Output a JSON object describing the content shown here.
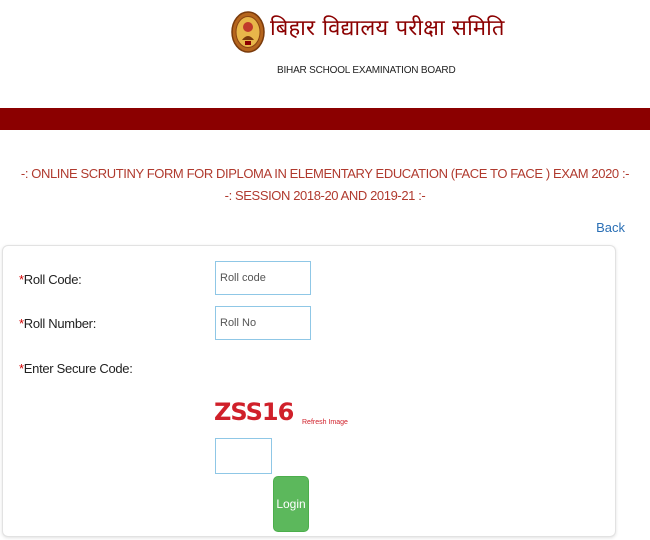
{
  "header": {
    "hindi_title": "बिहार विद्यालय परीक्षा समिति",
    "english_title": "BIHAR SCHOOL EXAMINATION BOARD"
  },
  "colors": {
    "band": "#8b0000",
    "heading": "#b03a2e",
    "link": "#2a6fb5",
    "captcha": "#d0202a",
    "login_button": "#5cb85c"
  },
  "page": {
    "heading_line1": "-: ONLINE SCRUTINY FORM FOR DIPLOMA IN ELEMENTARY EDUCATION (FACE TO FACE ) EXAM 2020 :-",
    "heading_line2": "-: SESSION 2018-20 AND 2019-21 :-",
    "back_label": "Back"
  },
  "form": {
    "required_marker": "*",
    "roll_code_label": "Roll Code:",
    "roll_code_placeholder": "Roll code",
    "roll_number_label": "Roll Number:",
    "roll_number_placeholder": "Roll No",
    "secure_code_label": "Enter Secure Code:",
    "captcha_text": "ZSS16",
    "refresh_label": "Refresh Image",
    "login_label": "Login"
  }
}
